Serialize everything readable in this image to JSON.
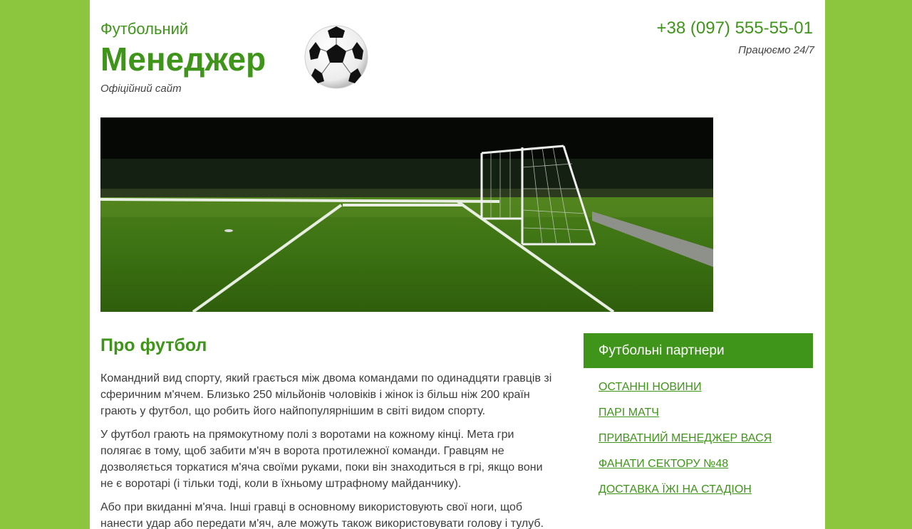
{
  "header": {
    "brand_small": "Футбольний",
    "brand_big": "Менеджер",
    "brand_sub": "Офіційний сайт",
    "phone": "+38 (097) 555-55-01",
    "hours": "Працюємо 24/7",
    "logo_icon": "soccer-ball-icon"
  },
  "main": {
    "title": "Про футбол",
    "paragraphs": [
      "Командний вид спорту, який грається між двома командами по одинадцяти гравців зі сферичним м'ячем. Близько 250 мільйонів чоловіків і жінок із більш ніж 200 країн грають у футбол, що робить його найпопулярнішим в світі видом спорту.",
      "У футбол грають на прямокутному полі з воротами на кожному кінці. Мета гри полягає в тому, щоб забити м'яч в ворота протилежної команди. Гравцям не дозволяється торкатися м'яча своїми руками, поки він знаходиться в грі, якщо вони не є воротарі (і тільки тоді, коли в їхньому штрафному майданчику).",
      "Або при вкиданні м'яча. Інші гравці в основному використовують свої ноги, щоб нанести удар або передати м'яч, але можуть також використовувати голову і тулуб."
    ]
  },
  "sidebar": {
    "title": "Футбольні партнери",
    "links": [
      "Останні новини",
      "Парі матч",
      "Приватний менеджер Вася",
      "Фанати сектору №48",
      "Доставка їжі на стадіон"
    ]
  },
  "colors": {
    "background": "#8cc63f",
    "accent": "#3f951a",
    "text": "#3c3c3c"
  }
}
